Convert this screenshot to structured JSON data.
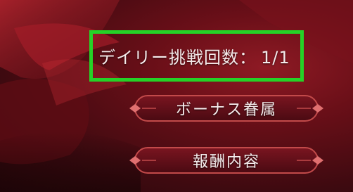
{
  "daily_challenge": {
    "label": "デイリー挑戦回数：",
    "count": "1/1"
  },
  "buttons": {
    "bonus_label": "ボーナス眷属",
    "reward_label": "報酬内容"
  },
  "colors": {
    "highlight": "#25d227",
    "accent_red": "#8e1a24",
    "button_border": "#c24a4a"
  }
}
